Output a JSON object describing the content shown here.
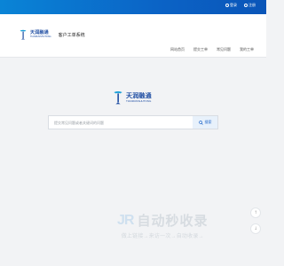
{
  "topbar": {
    "links": [
      {
        "label": "登录",
        "icon": "user-icon"
      },
      {
        "label": "注册",
        "icon": "register-icon"
      }
    ]
  },
  "brand": {
    "logo_cn": "天润融通",
    "logo_en": "TIANRUNSHUTONG",
    "subtitle": "客户工单系统"
  },
  "nav": {
    "items": [
      "网站首页",
      "提交工单",
      "常见问题",
      "我的工单"
    ]
  },
  "center_logo": {
    "logo_cn": "天润融通",
    "logo_en": "TIANRUNSHUTONG"
  },
  "search": {
    "placeholder": "提交常见问题或者关键词的问题",
    "button_label": "搜索"
  },
  "watermark": {
    "brand": "JR",
    "title": "自动秒收录",
    "tagline": "做上链接→来访一次→自动收录→"
  },
  "floats": {
    "up": "↑",
    "down": "↓"
  },
  "colors": {
    "brand_blue": "#1f4ea3",
    "bar": "#0a84d6",
    "accent": "#1a62c8"
  }
}
